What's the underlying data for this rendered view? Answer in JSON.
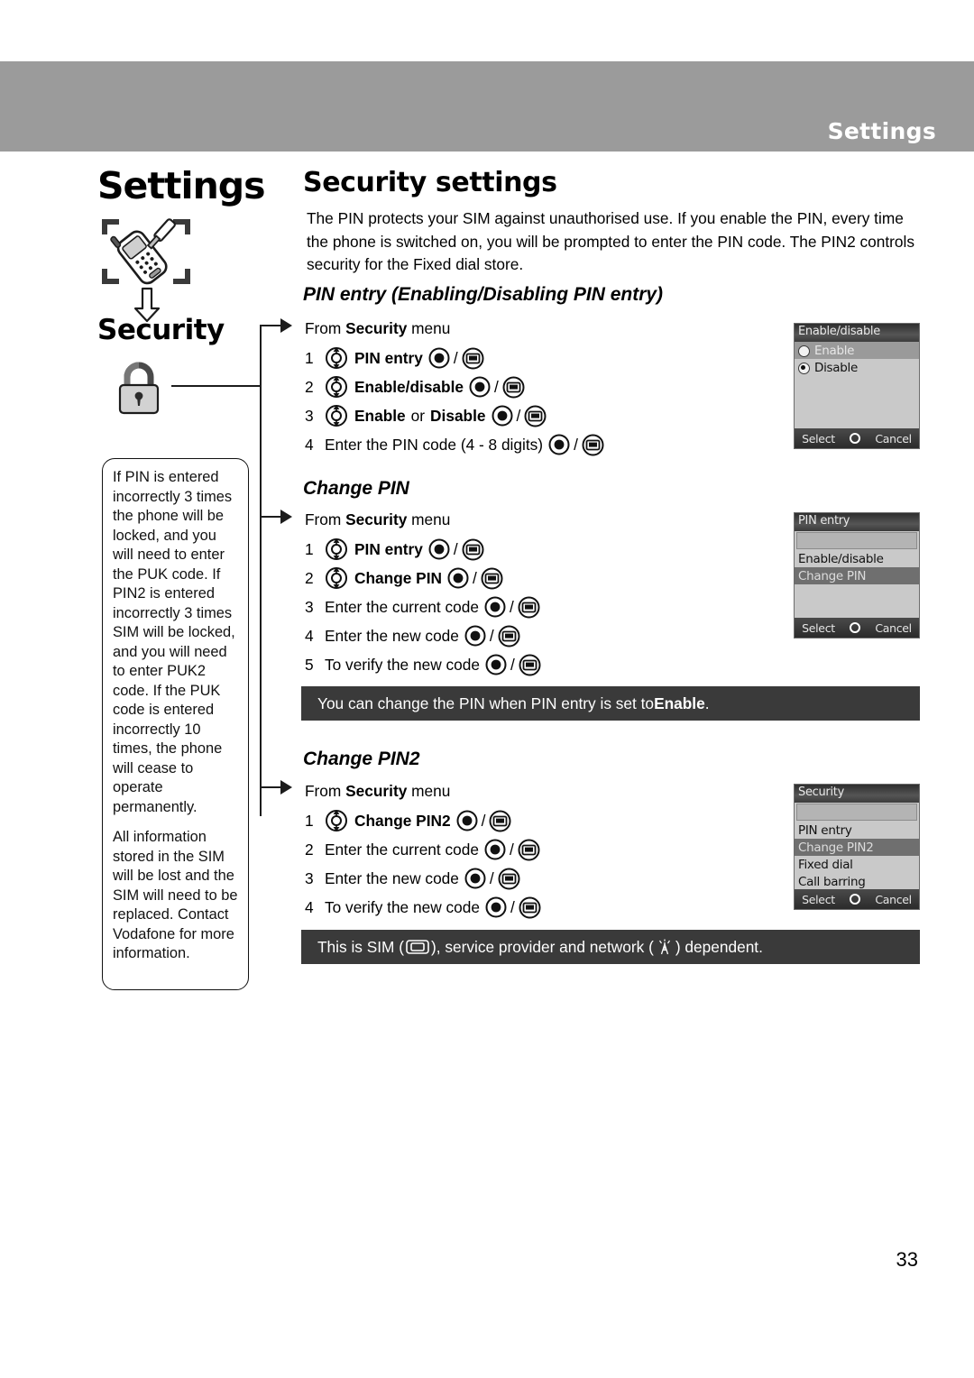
{
  "header": {
    "title": "Settings"
  },
  "sidebar": {
    "chapter_title": "Settings",
    "phone_tool_icon": "phone-with-screwdriver-icon",
    "down_arrow_icon": "arrow-down-icon",
    "security_label": "Security",
    "padlock_icon": "padlock-icon"
  },
  "note_box": {
    "paragraphs": [
      "If PIN is entered incorrectly 3 times the phone will be locked, and you will need to enter the PUK code. If PIN2 is entered incorrectly 3 times SIM will be locked, and you will need to enter PUK2 code. If the PUK code is entered incorrectly 10 times, the phone will cease to operate permanently.",
      "All information stored in the SIM will be lost and the SIM will need to be replaced. Contact Vodafone for more information."
    ]
  },
  "main": {
    "section_title": "Security settings",
    "intro": "The PIN protects your SIM against unauthorised use. If you enable the PIN, every time the phone is switched on, you will be prompted to enter the PIN code. The PIN2 controls security for the Fixed dial store.",
    "from_prefix": "From ",
    "from_bold": "Security",
    "from_suffix": " menu",
    "slash": "/",
    "icons": {
      "nav": "nav-updown-key-icon",
      "select": "select-key-icon",
      "softkey": "soft-key-icon"
    },
    "sections": [
      {
        "heading": "PIN entry (Enabling/Disabling PIN entry)",
        "steps": [
          {
            "num": "1",
            "nav": true,
            "bold": "PIN entry",
            "plain": ""
          },
          {
            "num": "2",
            "nav": true,
            "bold": "Enable/disable",
            "plain": ""
          },
          {
            "num": "3",
            "nav": true,
            "bold": "Enable",
            "mid": " or ",
            "bold2": "Disable",
            "plain": ""
          },
          {
            "num": "4",
            "nav": false,
            "bold": "",
            "plain": "Enter the PIN code (4 - 8 digits)"
          }
        ]
      },
      {
        "heading": "Change PIN",
        "steps": [
          {
            "num": "1",
            "nav": true,
            "bold": "PIN entry",
            "plain": ""
          },
          {
            "num": "2",
            "nav": true,
            "bold": "Change PIN",
            "plain": ""
          },
          {
            "num": "3",
            "nav": false,
            "bold": "",
            "plain": "Enter the current code"
          },
          {
            "num": "4",
            "nav": false,
            "bold": "",
            "plain": "Enter the new code"
          },
          {
            "num": "5",
            "nav": false,
            "bold": "",
            "plain": "To verify the new code"
          }
        ]
      },
      {
        "heading": "Change PIN2",
        "steps": [
          {
            "num": "1",
            "nav": true,
            "bold": "Change PIN2",
            "plain": ""
          },
          {
            "num": "2",
            "nav": false,
            "bold": "",
            "plain": "Enter the current code"
          },
          {
            "num": "3",
            "nav": false,
            "bold": "",
            "plain": "Enter the new code"
          },
          {
            "num": "4",
            "nav": false,
            "bold": "",
            "plain": "To verify the new code"
          }
        ]
      }
    ],
    "notes": [
      {
        "pre": "You can change the PIN when PIN entry is set to ",
        "bold": "Enable",
        "post": "."
      },
      {
        "pre": "This is SIM (",
        "sim_icon": "sim-card-icon",
        "mid": "), service provider and network (",
        "net_icon": "network-antenna-icon",
        "post": ") dependent."
      }
    ]
  },
  "screens": [
    {
      "title": "Enable/disable",
      "has_blank": false,
      "rows": [
        {
          "label": "Enable",
          "style": "hl-lt",
          "radio": "off"
        },
        {
          "label": "Disable",
          "style": "none",
          "radio": "on"
        }
      ],
      "softkeys": {
        "left": "Select",
        "center": "select-ring-icon",
        "right": "Cancel"
      }
    },
    {
      "title": "PIN entry",
      "has_blank": true,
      "rows": [
        {
          "label": "Enable/disable",
          "style": "none",
          "radio": "none"
        },
        {
          "label": "Change PIN",
          "style": "hl",
          "radio": "none"
        }
      ],
      "softkeys": {
        "left": "Select",
        "center": "select-ring-icon",
        "right": "Cancel"
      }
    },
    {
      "title": "Security",
      "has_blank": true,
      "rows": [
        {
          "label": "PIN entry",
          "style": "none",
          "radio": "none"
        },
        {
          "label": "Change PIN2",
          "style": "hl",
          "radio": "none"
        },
        {
          "label": "Fixed dial",
          "style": "none",
          "radio": "none"
        },
        {
          "label": "Call barring",
          "style": "none",
          "radio": "none"
        }
      ],
      "softkeys": {
        "left": "Select",
        "center": "select-ring-icon",
        "right": "Cancel"
      }
    }
  ],
  "page_number": "33"
}
